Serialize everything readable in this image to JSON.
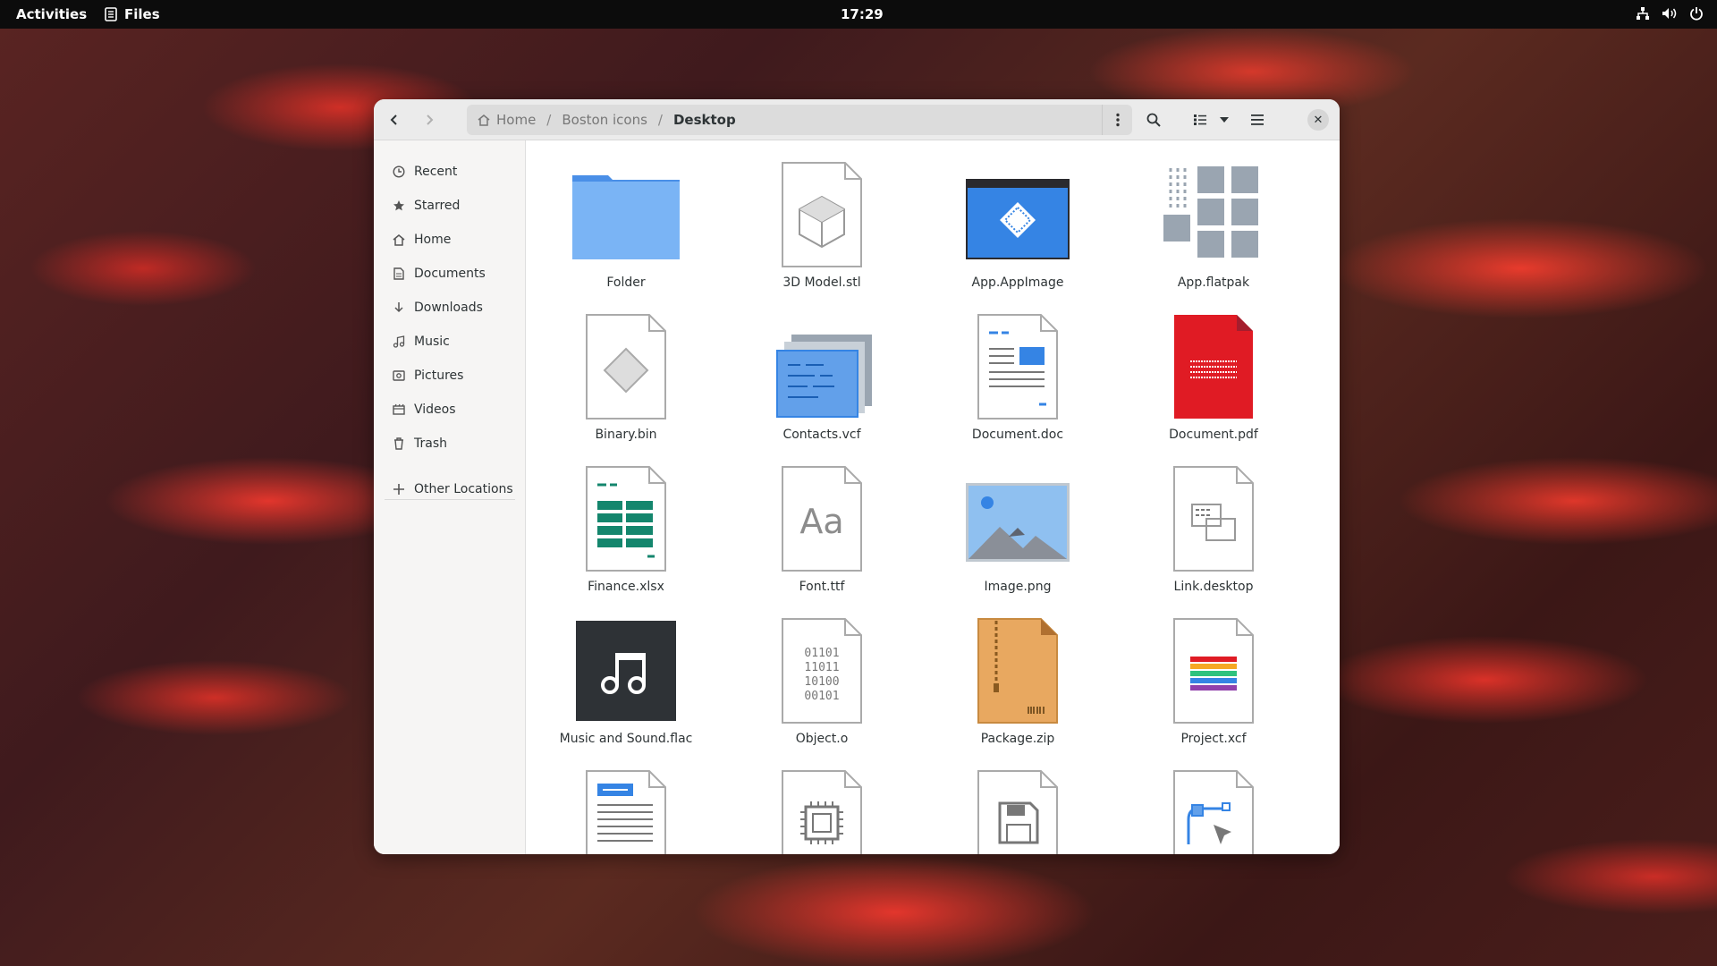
{
  "topbar": {
    "activities": "Activities",
    "app_name": "Files",
    "clock": "17:29"
  },
  "window": {
    "path": {
      "home": "Home",
      "parent": "Boston icons",
      "current": "Desktop"
    },
    "sidebar": {
      "items": [
        {
          "label": "Recent",
          "icon": "clock-icon"
        },
        {
          "label": "Starred",
          "icon": "star-icon"
        },
        {
          "label": "Home",
          "icon": "home-icon"
        },
        {
          "label": "Documents",
          "icon": "document-icon"
        },
        {
          "label": "Downloads",
          "icon": "download-icon"
        },
        {
          "label": "Music",
          "icon": "music-icon"
        },
        {
          "label": "Pictures",
          "icon": "picture-icon"
        },
        {
          "label": "Videos",
          "icon": "video-icon"
        },
        {
          "label": "Trash",
          "icon": "trash-icon"
        }
      ],
      "other_locations": "Other Locations"
    },
    "files": [
      {
        "name": "Folder",
        "icon": "folder-icon"
      },
      {
        "name": "3D Model.stl",
        "icon": "3d-model-icon"
      },
      {
        "name": "App.AppImage",
        "icon": "appimage-icon"
      },
      {
        "name": "App.flatpak",
        "icon": "flatpak-icon"
      },
      {
        "name": "Binary.bin",
        "icon": "binary-icon"
      },
      {
        "name": "Contacts.vcf",
        "icon": "contacts-icon"
      },
      {
        "name": "Document.doc",
        "icon": "document-doc-icon"
      },
      {
        "name": "Document.pdf",
        "icon": "pdf-icon"
      },
      {
        "name": "Finance.xlsx",
        "icon": "spreadsheet-icon"
      },
      {
        "name": "Font.ttf",
        "icon": "font-icon"
      },
      {
        "name": "Image.png",
        "icon": "image-icon"
      },
      {
        "name": "Link.desktop",
        "icon": "desktop-link-icon"
      },
      {
        "name": "Music and Sound.flac",
        "icon": "audio-icon"
      },
      {
        "name": "Object.o",
        "icon": "object-icon"
      },
      {
        "name": "Package.zip",
        "icon": "archive-icon"
      },
      {
        "name": "Project.xcf",
        "icon": "xcf-icon"
      },
      {
        "name": "",
        "icon": "text-document-icon"
      },
      {
        "name": "",
        "icon": "firmware-icon"
      },
      {
        "name": "",
        "icon": "disk-image-icon"
      },
      {
        "name": "",
        "icon": "vector-icon"
      }
    ],
    "font_glyph": "Aa"
  },
  "colors": {
    "folder_blue": "#62a0ea",
    "accent_blue": "#3584e4",
    "pdf_red": "#e01b24",
    "sheet_green": "#26a269",
    "zip_orange": "#e5a50a"
  }
}
